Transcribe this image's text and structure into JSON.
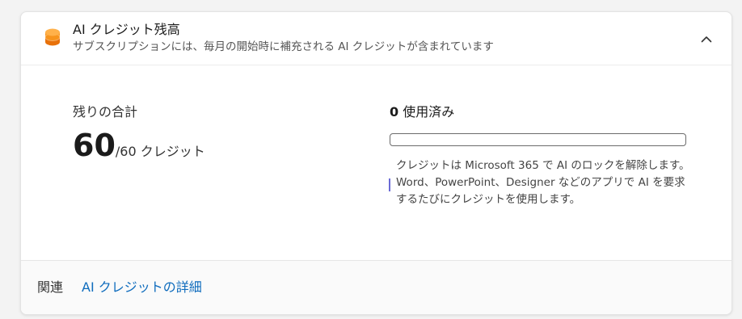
{
  "header": {
    "title": "AI クレジット残高",
    "subtitle": "サブスクリプションには、毎月の開始時に補充される AI クレジットが含まれています",
    "icon": "coin-stack-icon",
    "collapse_icon": "chevron-up-icon"
  },
  "remaining": {
    "label": "残りの合計",
    "value": "60",
    "suffix": "/60 クレジット"
  },
  "usage": {
    "value": "0",
    "label": "使用済み",
    "progress_fraction": 0,
    "description": "クレジットは Microsoft 365 で AI のロックを解除します。Word、PowerPoint、Designer などのアプリで AI を要求するたびにクレジットを使用します。"
  },
  "footer": {
    "related_label": "関連",
    "details_link": "AI クレジットの詳細"
  },
  "colors": {
    "accent": "#0f6cbd",
    "coin": "#f7941d"
  }
}
